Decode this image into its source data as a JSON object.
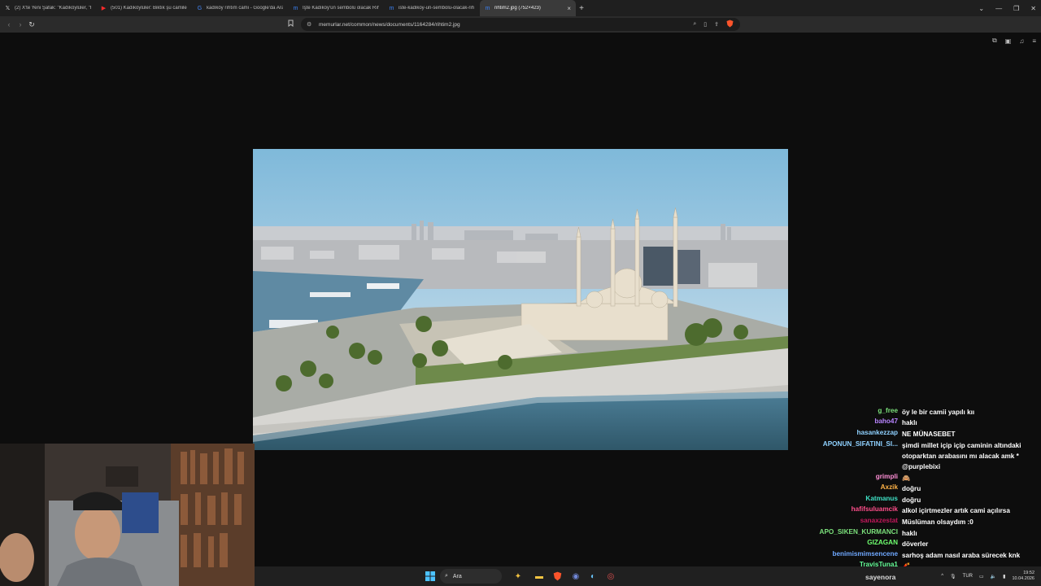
{
  "tabs": [
    {
      "icon": "x-icon",
      "title": "(2) X'te Yeni Şafak: \"Kadıköylüler, \"Ra",
      "active": false
    },
    {
      "icon": "youtube-icon",
      "title": "(501) Kadıköylüler: Biktık şu camilerd",
      "active": false
    },
    {
      "icon": "google-icon",
      "title": "kadıköy rıhtım cami - Google'da Ara",
      "active": false
    },
    {
      "icon": "memurlar-icon",
      "title": "İşte Kadıköy'ün sembolü olacak Rıhtı",
      "active": false
    },
    {
      "icon": "memurlar-icon",
      "title": "iste-kadikoy-un-sembolu-olacak-rih",
      "active": false
    },
    {
      "icon": "memurlar-icon",
      "title": "rihtim2.jpg (752×423)",
      "active": true
    }
  ],
  "address": {
    "url": "memurlar.net/common/news/documents/1164284/rihtim2.jpg"
  },
  "chat": [
    {
      "user": "g_free",
      "color": "#7be07b",
      "text": "öy le bir camii yapılı kıı"
    },
    {
      "user": "baho47",
      "color": "#b884ff",
      "text": "haklı"
    },
    {
      "user": "hasankezzap",
      "color": "#8fd1ff",
      "text": "NE MÜNASEBET"
    },
    {
      "user": "APONUN_SIFATINI_SI...",
      "color": "#8fd1ff",
      "text": "şimdi millet içip içip caminin altındaki otoparktan arabasını mı alacak amk * @purplebixi"
    },
    {
      "user": "grimpli",
      "color": "#ff8fd6",
      "text": "🙈"
    },
    {
      "user": "Axzik",
      "color": "#ffb347",
      "text": "doğru"
    },
    {
      "user": "Katmanus",
      "color": "#3fe0c5",
      "text": "doğru"
    },
    {
      "user": "hafifsuluamcik",
      "color": "#ff4f8b",
      "text": "alkol içirtmezler artık cami açılırsa"
    },
    {
      "user": "sanaxzestat",
      "color": "#c2185b",
      "text": "Müslüman olsaydım :0"
    },
    {
      "user": "APO_SIKEN_KURMANCI",
      "color": "#7be07b",
      "text": "haklı"
    },
    {
      "user": "GIZAGAN",
      "color": "#6fff6f",
      "text": "döverler"
    },
    {
      "user": "benimismimsencene",
      "color": "#6fa8ff",
      "text": "sarhoş adam nasıl araba sürecek knk"
    },
    {
      "user": "TravisTuna1",
      "color": "#66ff99",
      "text": "🧨"
    }
  ],
  "taskbar": {
    "search_placeholder": "Ara",
    "language": "TUR",
    "time": "19:52",
    "date": "10.04.2026",
    "extra_user": "sayenora"
  },
  "colors": {
    "background": "#0d0d0d",
    "tab_bar": "#1f1f1f",
    "address_bar": "#2b2b2b",
    "accent_brave": "#fb542b"
  }
}
